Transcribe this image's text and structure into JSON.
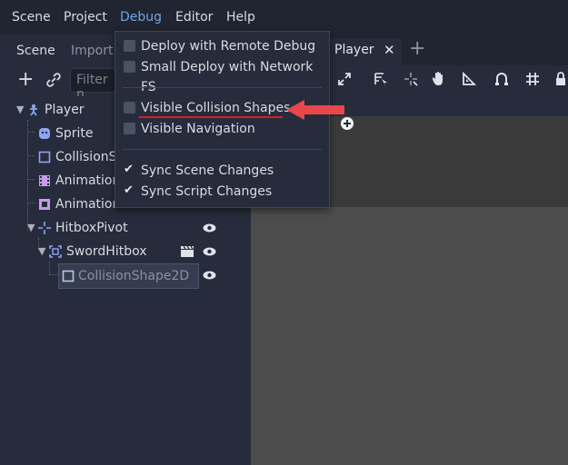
{
  "menubar": {
    "items": [
      "Scene",
      "Project",
      "Debug",
      "Editor",
      "Help"
    ]
  },
  "left_dock": {
    "tabs": [
      "Scene",
      "Import"
    ],
    "filter_placeholder": "Filter n"
  },
  "scene_tree": {
    "nodes": [
      {
        "label": "Player",
        "icon": "player-node-icon"
      },
      {
        "label": "Sprite",
        "icon": "sprite-icon"
      },
      {
        "label": "CollisionS",
        "icon": "collision-shape-icon"
      },
      {
        "label": "Animation",
        "icon": "animation-player-icon"
      },
      {
        "label": "AnimationTree",
        "icon": "animation-tree-icon"
      },
      {
        "label": "HitboxPivot",
        "icon": "position2d-icon"
      },
      {
        "label": "SwordHitbox",
        "icon": "area2d-icon"
      },
      {
        "label": "CollisionShape2D",
        "icon": "collision-shape-icon"
      }
    ]
  },
  "main": {
    "scene_tab_label": "Player",
    "close_glyph": "✕",
    "add_tab_glyph": "+"
  },
  "debug_menu": {
    "group1": [
      {
        "label": "Deploy with Remote Debug",
        "checked": false
      },
      {
        "label": "Small Deploy with Network FS",
        "checked": false
      }
    ],
    "group2": [
      {
        "label": "Visible Collision Shapes",
        "checked": false
      },
      {
        "label": "Visible Navigation",
        "checked": false
      }
    ],
    "group3": [
      {
        "label": "Sync Scene Changes",
        "checked": true
      },
      {
        "label": "Sync Script Changes",
        "checked": true
      }
    ]
  },
  "annotation": {
    "arrow_color": "#e8474c",
    "underline_color": "#d81f1f"
  },
  "colors": {
    "accent": "#6fa3e6",
    "background": "#202531",
    "panel": "#262c3b",
    "viewport": "#4d4d4d"
  }
}
